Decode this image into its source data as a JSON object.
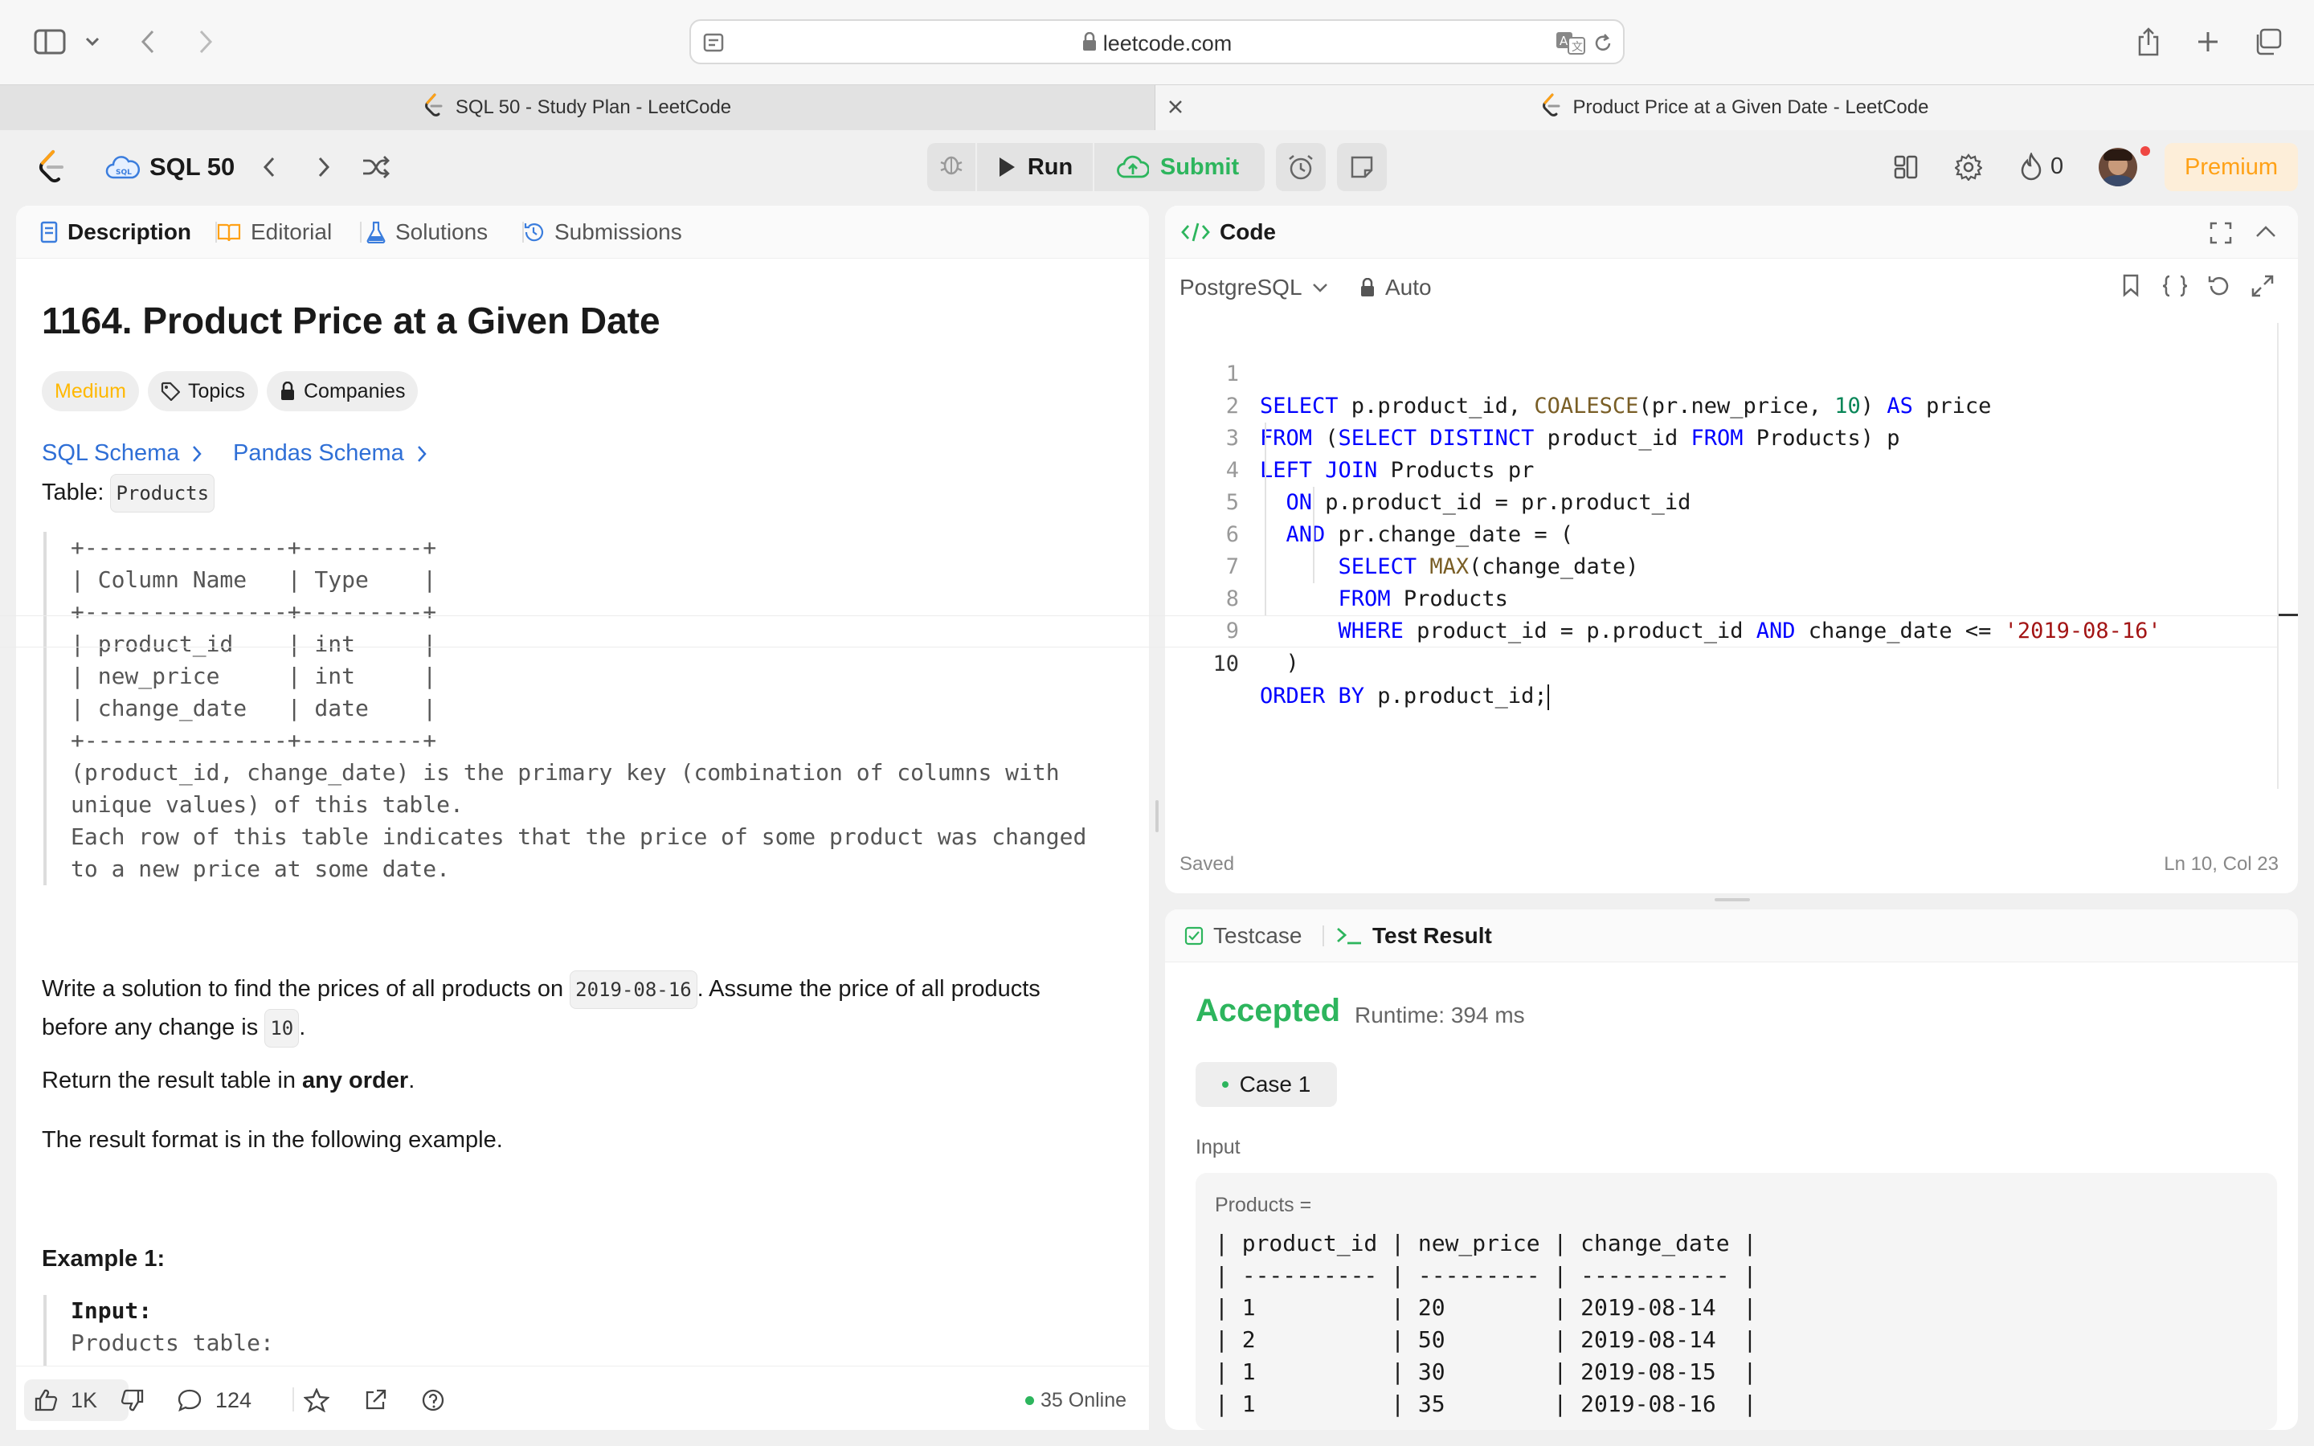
{
  "browser": {
    "url": "leetcode.com",
    "tabs": [
      {
        "title": "SQL 50 - Study Plan - LeetCode",
        "active": false
      },
      {
        "title": "Product Price at a Given Date - LeetCode",
        "active": true
      }
    ]
  },
  "topbar": {
    "study_plan": "SQL 50",
    "run_label": "Run",
    "submit_label": "Submit",
    "streak_count": "0",
    "premium_label": "Premium"
  },
  "left_panel": {
    "tabs": [
      "Description",
      "Editorial",
      "Solutions",
      "Submissions"
    ],
    "title": "1164. Product Price at a Given Date",
    "difficulty": "Medium",
    "topics_label": "Topics",
    "companies_label": "Companies",
    "sql_schema_label": "SQL Schema",
    "pandas_schema_label": "Pandas Schema",
    "table_prefix": "Table:",
    "table_name": "Products",
    "schema_text": "+---------------+---------+\n| Column Name   | Type    |\n+---------------+---------+\n| product_id    | int     |\n| new_price     | int     |\n| change_date   | date    |\n+---------------+---------+\n(product_id, change_date) is the primary key (combination of columns with\nunique values) of this table.\nEach row of this table indicates that the price of some product was changed\nto a new price at some date.",
    "prompt_part1": "Write a solution to find the prices of all products on ",
    "prompt_date": "2019-08-16",
    "prompt_part2": ". Assume the price of all products",
    "prompt_part3": "before any change is ",
    "prompt_default": "10",
    "prompt_part4": ".",
    "return_prefix": "Return the result table in ",
    "return_bold": "any order",
    "return_suffix": ".",
    "format_text": "The result format is in the following example.",
    "example_heading": "Example 1:",
    "example_input_label": "Input:",
    "example_input_table": "Products table:",
    "footer": {
      "likes": "1K",
      "comments": "124",
      "online": "35 Online"
    }
  },
  "code_panel": {
    "title": "Code",
    "language": "PostgreSQL",
    "mode": "Auto",
    "status": "Saved",
    "cursor": "Ln 10, Col 23",
    "line_numbers": [
      "1",
      "2",
      "3",
      "4",
      "5",
      "6",
      "7",
      "8",
      "9",
      "10"
    ],
    "lines": [
      "SELECT p.product_id, COALESCE(pr.new_price, 10) AS price",
      "FROM (SELECT DISTINCT product_id FROM Products) p",
      "LEFT JOIN Products pr",
      "  ON p.product_id = pr.product_id",
      "  AND pr.change_date = (",
      "      SELECT MAX(change_date)",
      "      FROM Products",
      "      WHERE product_id = p.product_id AND change_date <= '2019-08-16'",
      "  )",
      "ORDER BY p.product_id;"
    ]
  },
  "result_panel": {
    "tabs": [
      "Testcase",
      "Test Result"
    ],
    "verdict": "Accepted",
    "runtime": "Runtime: 394 ms",
    "case_label": "Case 1",
    "input_label": "Input",
    "input_var": "Products =",
    "table_lines": [
      "| product_id | new_price | change_date |",
      "| ---------- | --------- | ----------- |",
      "| 1          | 20        | 2019-08-14  |",
      "| 2          | 50        | 2019-08-14  |",
      "| 1          | 30        | 2019-08-15  |",
      "| 1          | 35        | 2019-08-16  |"
    ]
  },
  "colors": {
    "accepted": "#2db55d",
    "submit": "#2db55d",
    "difficulty_medium": "#ffb800",
    "premium": "#ffa116",
    "link": "#2f6fd6"
  }
}
